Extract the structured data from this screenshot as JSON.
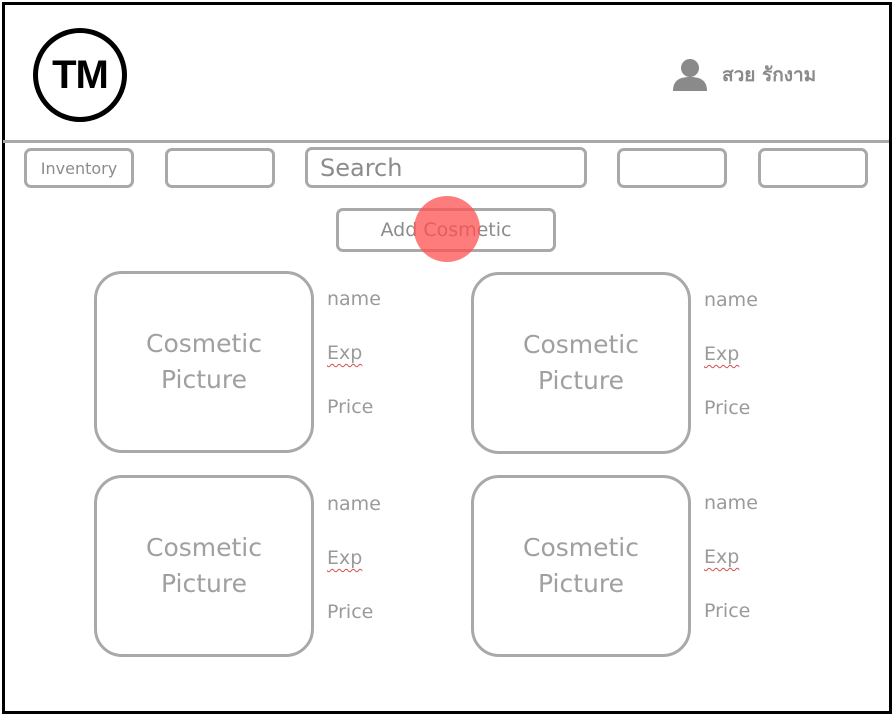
{
  "header": {
    "logo_text": "TM",
    "user_icon": "user-icon",
    "user_name": "สวย รักงาม"
  },
  "nav": {
    "inventory_label": "Inventory",
    "search_placeholder": "Search",
    "empty_buttons": [
      "",
      "",
      ""
    ]
  },
  "actions": {
    "add_label": "Add Cosmetic"
  },
  "cards": [
    {
      "picture_line1": "Cosmetic",
      "picture_line2": "Picture",
      "name_label": "name",
      "exp_label": "Exp",
      "price_label": "Price"
    },
    {
      "picture_line1": "Cosmetic",
      "picture_line2": "Picture",
      "name_label": "name",
      "exp_label": "Exp",
      "price_label": "Price"
    },
    {
      "picture_line1": "Cosmetic",
      "picture_line2": "Picture",
      "name_label": "name",
      "exp_label": "Exp",
      "price_label": "Price"
    },
    {
      "picture_line1": "Cosmetic",
      "picture_line2": "Picture",
      "name_label": "name",
      "exp_label": "Exp",
      "price_label": "Price"
    }
  ],
  "colors": {
    "border": "#a9a9a9",
    "text_muted": "#8c8c8c",
    "cursor": "#ff5050"
  }
}
